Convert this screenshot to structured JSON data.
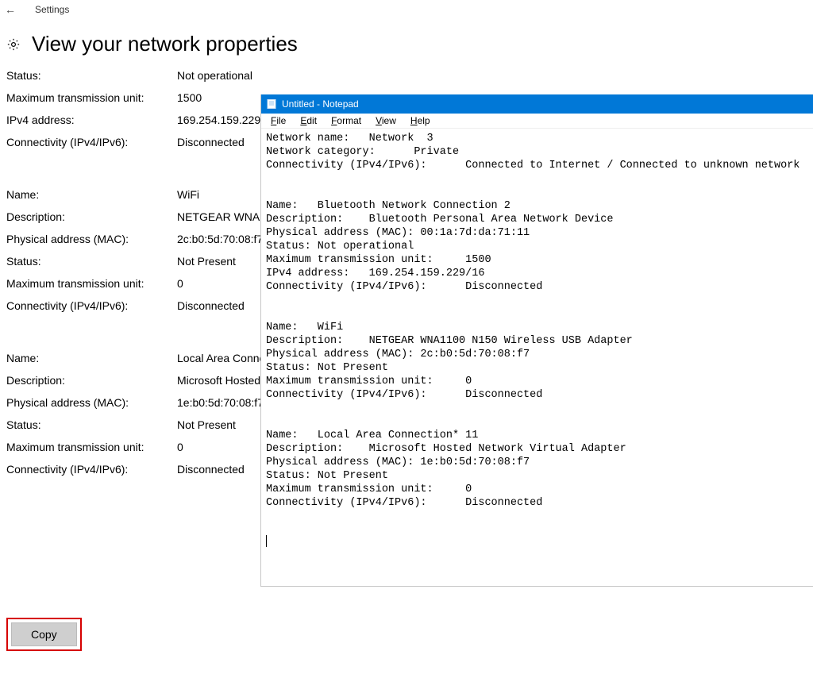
{
  "settings": {
    "back_glyph": "←",
    "app_title": "Settings",
    "page_title": "View your network properties",
    "copy_label": "Copy"
  },
  "props": {
    "top": [
      {
        "label": "Status:",
        "value": "Not operational"
      },
      {
        "label": "Maximum transmission unit:",
        "value": "1500"
      },
      {
        "label": "IPv4 address:",
        "value": "169.254.159.229/16"
      },
      {
        "label": "Connectivity (IPv4/IPv6):",
        "value": "Disconnected"
      }
    ],
    "wifi": [
      {
        "label": "Name:",
        "value": "WiFi"
      },
      {
        "label": "Description:",
        "value": "NETGEAR WNA1100 N150 Wireless USB Adapter"
      },
      {
        "label": "Physical address (MAC):",
        "value": "2c:b0:5d:70:08:f7"
      },
      {
        "label": "Status:",
        "value": "Not Present"
      },
      {
        "label": "Maximum transmission unit:",
        "value": "0"
      },
      {
        "label": "Connectivity (IPv4/IPv6):",
        "value": "Disconnected"
      }
    ],
    "lan": [
      {
        "label": "Name:",
        "value": "Local Area Connection* 11"
      },
      {
        "label": "Description:",
        "value": "Microsoft Hosted Network Virtual Adapter"
      },
      {
        "label": "Physical address (MAC):",
        "value": "1e:b0:5d:70:08:f7"
      },
      {
        "label": "Status:",
        "value": "Not Present"
      },
      {
        "label": "Maximum transmission unit:",
        "value": "0"
      },
      {
        "label": "Connectivity (IPv4/IPv6):",
        "value": "Disconnected"
      }
    ]
  },
  "notepad": {
    "title": "Untitled - Notepad",
    "menu": {
      "file": "File",
      "edit": "Edit",
      "format": "Format",
      "view": "View",
      "help": "Help"
    },
    "body": "Network name:   Network  3\nNetwork category:      Private\nConnectivity (IPv4/IPv6):      Connected to Internet / Connected to unknown network\n\n\nName:   Bluetooth Network Connection 2\nDescription:    Bluetooth Personal Area Network Device\nPhysical address (MAC): 00:1a:7d:da:71:11\nStatus: Not operational\nMaximum transmission unit:     1500\nIPv4 address:   169.254.159.229/16\nConnectivity (IPv4/IPv6):      Disconnected\n\n\nName:   WiFi\nDescription:    NETGEAR WNA1100 N150 Wireless USB Adapter\nPhysical address (MAC): 2c:b0:5d:70:08:f7\nStatus: Not Present\nMaximum transmission unit:     0\nConnectivity (IPv4/IPv6):      Disconnected\n\n\nName:   Local Area Connection* 11\nDescription:    Microsoft Hosted Network Virtual Adapter\nPhysical address (MAC): 1e:b0:5d:70:08:f7\nStatus: Not Present\nMaximum transmission unit:     0\nConnectivity (IPv4/IPv6):      Disconnected"
  }
}
